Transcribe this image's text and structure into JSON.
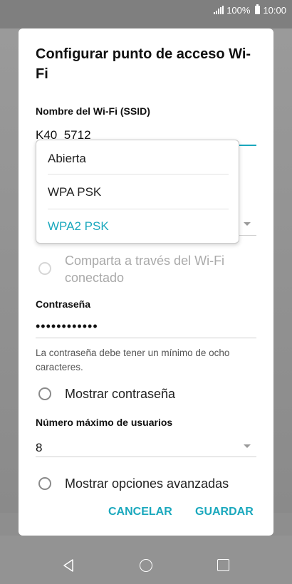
{
  "status_bar": {
    "battery": "100%",
    "time": "10:00"
  },
  "dialog": {
    "title": "Configurar punto de acceso Wi-Fi",
    "ssid": {
      "label": "Nombre del Wi-Fi (SSID)",
      "value": "K40_5712"
    },
    "security_menu": {
      "options": [
        "Abierta",
        "WPA PSK",
        "WPA2 PSK"
      ],
      "selected": "WPA2 PSK"
    },
    "share_option": {
      "label": "Comparta a través del Wi-Fi conectado"
    },
    "password": {
      "label": "Contraseña",
      "value": "••••••••••••",
      "helper": "La contraseña debe tener un mínimo de ocho caracteres."
    },
    "show_password": {
      "label": "Mostrar contraseña"
    },
    "max_users": {
      "label": "Número máximo de usuarios",
      "value": "8"
    },
    "advanced": {
      "label": "Mostrar opciones avanzadas"
    },
    "buttons": {
      "cancel": "CANCELAR",
      "save": "GUARDAR"
    }
  },
  "colors": {
    "accent": "#1aa8bd",
    "scrim": "#8e8e8e"
  },
  "nav_bar": {
    "icons": [
      "back-icon",
      "home-icon",
      "recent-apps-icon"
    ]
  }
}
